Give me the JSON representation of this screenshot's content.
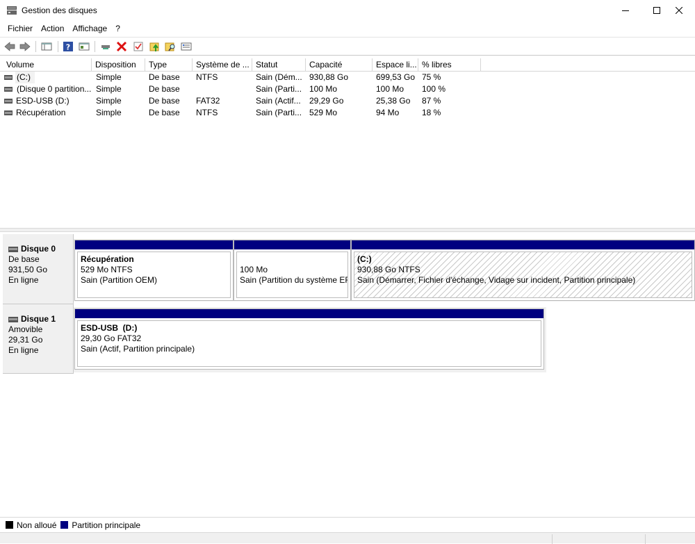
{
  "window": {
    "title": "Gestion des disques"
  },
  "menu": [
    "Fichier",
    "Action",
    "Affichage",
    "?"
  ],
  "toolbar": {
    "icons": [
      "back-icon",
      "forward-icon",
      "console-tree-icon",
      "help-icon",
      "properties-view-icon",
      "connect-icon",
      "delete-icon",
      "check-icon",
      "folder-up-icon",
      "search-folder-icon",
      "properties-icon"
    ]
  },
  "volume_list": {
    "headers": [
      "Volume",
      "Disposition",
      "Type",
      "Système de ...",
      "Statut",
      "Capacité",
      "Espace li...",
      "% libres"
    ],
    "rows": [
      [
        "(C:)",
        "Simple",
        "De base",
        "NTFS",
        "Sain (Dém...",
        "930,88 Go",
        "699,53 Go",
        "75 %"
      ],
      [
        "(Disque 0 partition...",
        "Simple",
        "De base",
        "",
        "Sain (Parti...",
        "100 Mo",
        "100 Mo",
        "100 %"
      ],
      [
        "ESD-USB (D:)",
        "Simple",
        "De base",
        "FAT32",
        "Sain (Actif...",
        "29,29 Go",
        "25,38 Go",
        "87 %"
      ],
      [
        "Récupération",
        "Simple",
        "De base",
        "NTFS",
        "Sain (Parti...",
        "529 Mo",
        "94 Mo",
        "18 %"
      ]
    ]
  },
  "disks": [
    {
      "name": "Disque 0",
      "type": "De base",
      "size": "931,50 Go",
      "state": "En ligne",
      "partitions": [
        {
          "name": "Récupération",
          "size": "529 Mo NTFS",
          "status": "Sain (Partition OEM)"
        },
        {
          "name": "",
          "size": "100 Mo",
          "status": "Sain (Partition du système EF"
        },
        {
          "name": "(C:)",
          "size": "930,88 Go NTFS",
          "status": "Sain (Démarrer, Fichier d'échange, Vidage sur incident, Partition principale)"
        }
      ]
    },
    {
      "name": "Disque 1",
      "type": "Amovible",
      "size": "29,31 Go",
      "state": "En ligne",
      "partitions": [
        {
          "name": "ESD-USB  (D:)",
          "size": "29,30 Go FAT32",
          "status": "Sain (Actif, Partition principale)"
        }
      ]
    }
  ],
  "legend": [
    {
      "label": "Non alloué",
      "color": "#000000"
    },
    {
      "label": "Partition principale",
      "color": "#000080"
    }
  ]
}
